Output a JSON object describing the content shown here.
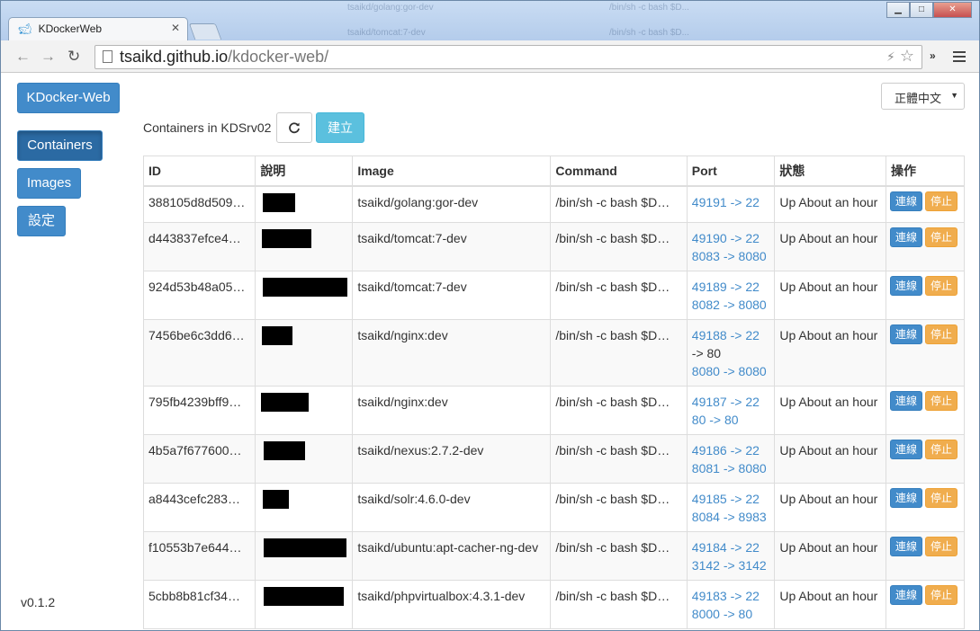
{
  "browser": {
    "tab_title": "KDockerWeb",
    "url_domain": "tsaikd.github.io",
    "url_path": "/kdocker-web/",
    "background_text": [
      "tsaikd/golang:gor-dev",
      "tsaikd/tomcat:7-dev",
      "/bin/sh -c bash $D...",
      "/bin/sh -c bash $D..."
    ]
  },
  "app": {
    "brand": "KDocker-Web",
    "nav": [
      "Containers",
      "Images",
      "設定"
    ],
    "active_nav": "Containers",
    "version": "v0.1.2",
    "language": "正體中文",
    "heading": "Containers in KDSrv02",
    "create_label": "建立",
    "accent_color": "#428bca",
    "warning_color": "#f0ad4e",
    "info_color": "#5bc0de"
  },
  "table": {
    "headers": [
      "ID",
      "說明",
      "Image",
      "Command",
      "Port",
      "狀態",
      "操作"
    ],
    "connect_label": "連線",
    "stop_label": "停止",
    "rows": [
      {
        "id": "388105d8d509…",
        "image": "tsaikd/golang:gor-dev",
        "command": "/bin/sh -c bash $D…",
        "ports": [
          "49191 -> 22"
        ],
        "status": "Up About an hour"
      },
      {
        "id": "d443837efce4…",
        "image": "tsaikd/tomcat:7-dev",
        "command": "/bin/sh -c bash $D…",
        "ports": [
          "49190 -> 22",
          "8083 -> 8080"
        ],
        "status": "Up About an hour"
      },
      {
        "id": "924d53b48a05…",
        "image": "tsaikd/tomcat:7-dev",
        "command": "/bin/sh -c bash $D…",
        "ports": [
          "49189 -> 22",
          "8082 -> 8080"
        ],
        "status": "Up About an hour"
      },
      {
        "id": "7456be6c3dd6…",
        "image": "tsaikd/nginx:dev",
        "command": "/bin/sh -c bash $D…",
        "ports": [
          "49188 -> 22",
          "-> 80",
          "8080 -> 8080"
        ],
        "status": "Up About an hour"
      },
      {
        "id": "795fb4239bff9…",
        "image": "tsaikd/nginx:dev",
        "command": "/bin/sh -c bash $D…",
        "ports": [
          "49187 -> 22",
          "80 -> 80"
        ],
        "status": "Up About an hour"
      },
      {
        "id": "4b5a7f677600…",
        "image": "tsaikd/nexus:2.7.2-dev",
        "command": "/bin/sh -c bash $D…",
        "ports": [
          "49186 -> 22",
          "8081 -> 8080"
        ],
        "status": "Up About an hour"
      },
      {
        "id": "a8443cefc283…",
        "image": "tsaikd/solr:4.6.0-dev",
        "command": "/bin/sh -c bash $D…",
        "ports": [
          "49185 -> 22",
          "8084 -> 8983"
        ],
        "status": "Up About an hour"
      },
      {
        "id": "f10553b7e644…",
        "image": "tsaikd/ubuntu:apt-cacher-ng-dev",
        "command": "/bin/sh -c bash $D…",
        "ports": [
          "49184 -> 22",
          "3142 -> 3142"
        ],
        "status": "Up About an hour"
      },
      {
        "id": "5cbb8b81cf34…",
        "image": "tsaikd/phpvirtualbox:4.3.1-dev",
        "command": "/bin/sh -c bash $D…",
        "ports": [
          "49183 -> 22",
          "8000 -> 80"
        ],
        "status": "Up About an hour"
      }
    ]
  }
}
